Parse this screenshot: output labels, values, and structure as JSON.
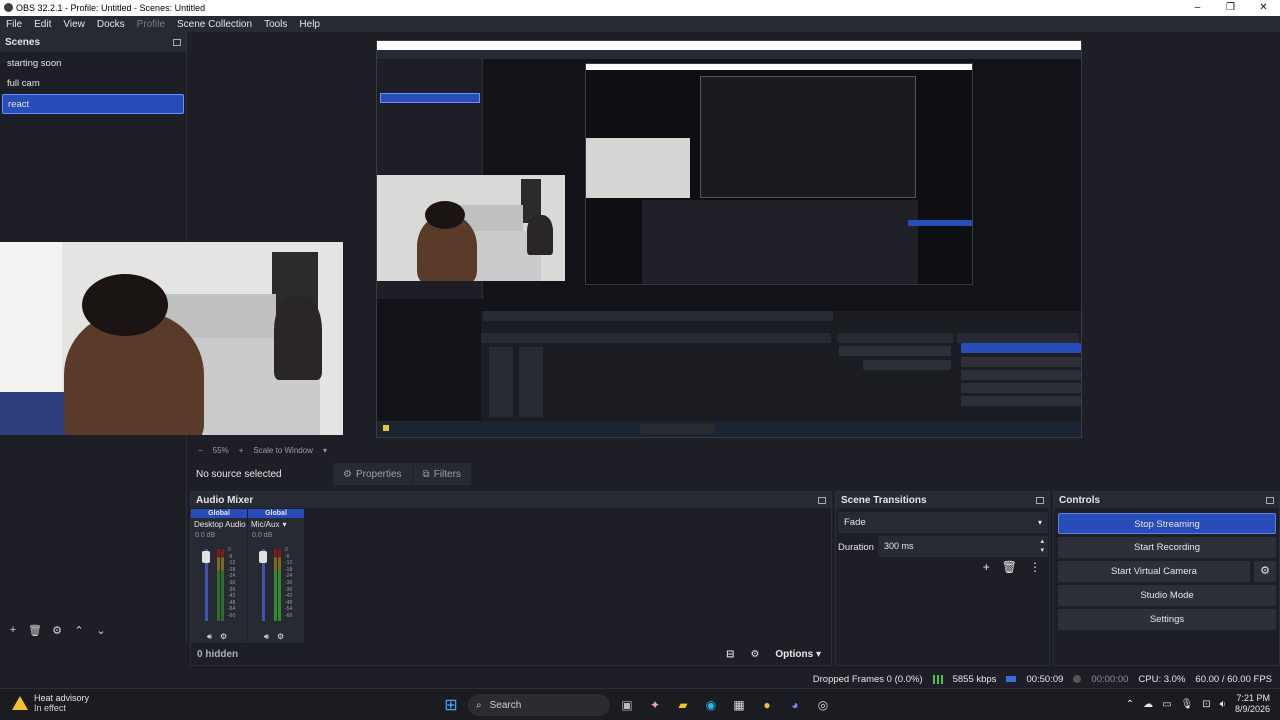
{
  "window": {
    "title": "OBS 32.2.1 - Profile: Untitled - Scenes: Untitled",
    "controls": [
      "–",
      "❐",
      "✕"
    ]
  },
  "menu": [
    "File",
    "Edit",
    "View",
    "Docks",
    "Profile",
    "Scene Collection",
    "Tools",
    "Help"
  ],
  "scenes": {
    "title": "Scenes",
    "items": [
      "starting soon",
      "full cam",
      "react"
    ],
    "active_index": 2
  },
  "preview": {
    "zoom": "55%",
    "scale_mode": "Scale to Window"
  },
  "source_bar": {
    "no_source": "No source selected",
    "properties": "Properties",
    "filters": "Filters"
  },
  "mixer": {
    "title": "Audio Mixer",
    "channels": [
      {
        "global": "Global",
        "name": "Desktop Audio",
        "db": "0.0 dB"
      },
      {
        "global": "Global",
        "name": "Mic/Aux",
        "db": "0.0 dB"
      }
    ],
    "scale": [
      "0",
      "-6",
      "-12",
      "-18",
      "-24",
      "-30",
      "-36",
      "-42",
      "-48",
      "-54",
      "-60"
    ],
    "hidden": "0 hidden",
    "options": "Options"
  },
  "transitions": {
    "title": "Scene Transitions",
    "selected": "Fade",
    "duration_label": "Duration",
    "duration_value": "300 ms"
  },
  "controls": {
    "title": "Controls",
    "stop_streaming": "Stop Streaming",
    "start_recording": "Start Recording",
    "start_virtual_camera": "Start Virtual Camera",
    "studio_mode": "Studio Mode",
    "settings": "Settings"
  },
  "status": {
    "dropped_frames": "Dropped Frames 0 (0.0%)",
    "bitrate": "5855 kbps",
    "stream_time": "00:50:09",
    "rec_time": "00:00:00",
    "cpu": "CPU: 3.0%",
    "fps": "60.00 / 60.00 FPS"
  },
  "taskbar": {
    "weather_title": "Heat advisory",
    "weather_sub": "In effect",
    "search": "Search",
    "time": "7:21 PM",
    "date": "8/9/2026"
  },
  "colors": {
    "accent": "#284cb8",
    "panel": "#272a33",
    "background": "#1e1f26"
  }
}
